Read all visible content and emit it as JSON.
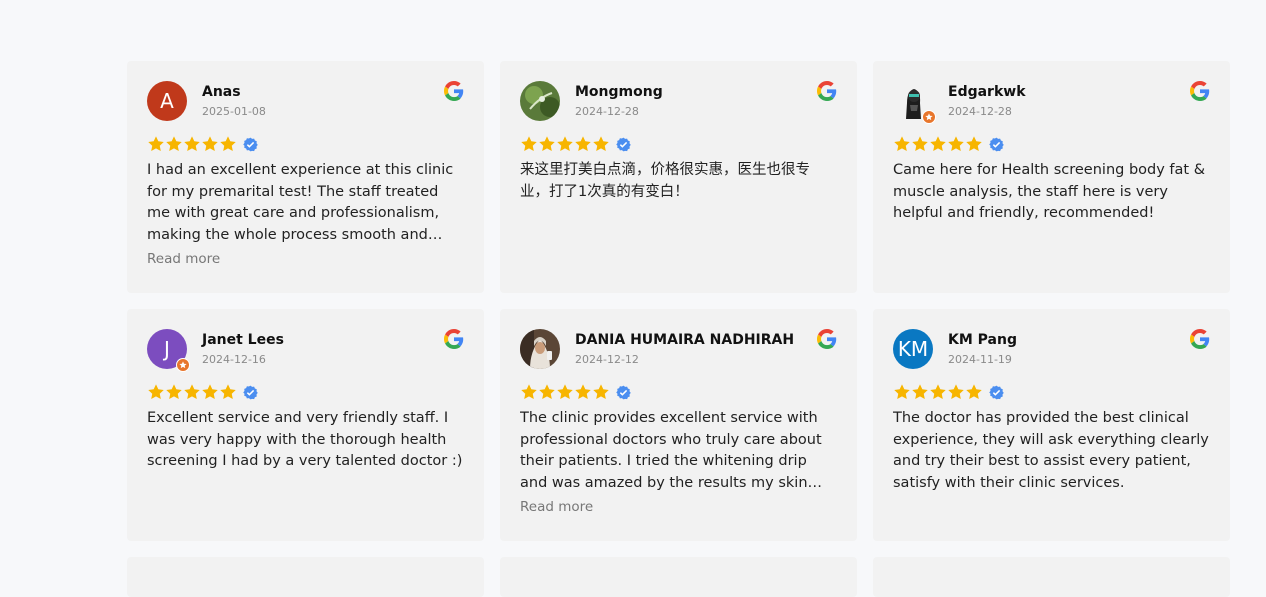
{
  "colors": {
    "star": "#f7b500",
    "verified": "#4b8ef0",
    "card_bg": "#f2f2f2",
    "page_bg": "#f7f8fa"
  },
  "icons": {
    "source_logo": "google-g-icon",
    "rating": "star-icon",
    "verified": "verified-badge-icon"
  },
  "reviews": [
    {
      "name": "Anas",
      "date": "2025-01-08",
      "rating": 5,
      "avatar": {
        "type": "letter",
        "letter": "A",
        "color": "#c0391b"
      },
      "text": "I had an excellent experience at this clinic for my premarital test! The staff treated me with great care and professionalism, making the whole process smooth and stress-free. The…",
      "read_more": "Read more"
    },
    {
      "name": "Mongmong",
      "date": "2024-12-28",
      "rating": 5,
      "avatar": {
        "type": "photo",
        "icon": "photo-avatar-icon"
      },
      "text": "来这里打美白点滴，价格很实惠，医生也很专业，打了1次真的有变白！",
      "read_more": ""
    },
    {
      "name": "Edgarkwk",
      "date": "2024-12-28",
      "rating": 5,
      "avatar": {
        "type": "photo",
        "icon": "photo-avatar-icon",
        "badge": true
      },
      "text": "Came here for Health screening body fat & muscle analysis, the staff here is very helpful and friendly, recommended!",
      "read_more": ""
    },
    {
      "name": "Janet Lees",
      "date": "2024-12-16",
      "rating": 5,
      "avatar": {
        "type": "letter",
        "letter": "J",
        "color": "#7c4dbf",
        "badge": true
      },
      "text": "Excellent service and very friendly staff. I was very happy with the thorough health screening I had by a very talented doctor :)",
      "read_more": ""
    },
    {
      "name": "DANIA HUMAIRA NADHIRAH",
      "date": "2024-12-12",
      "rating": 5,
      "avatar": {
        "type": "photo",
        "icon": "photo-avatar-icon"
      },
      "text": "The clinic provides excellent service with professional doctors who truly care about their patients. I tried the whitening drip and was amazed by the results my skin feels…",
      "read_more": "Read more"
    },
    {
      "name": "KM Pang",
      "date": "2024-11-19",
      "rating": 5,
      "avatar": {
        "type": "letter",
        "letter": "KM",
        "color": "#0a78c2"
      },
      "text": "The doctor has provided the best clinical experience, they will ask everything clearly and try their best to assist every patient, satisfy with their clinic services.",
      "read_more": ""
    }
  ]
}
